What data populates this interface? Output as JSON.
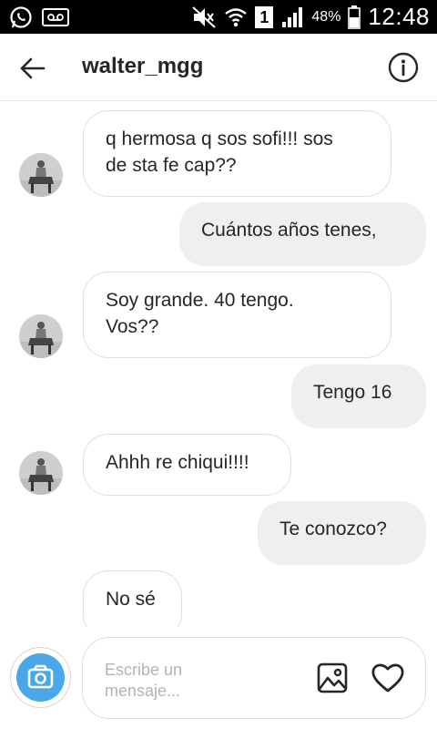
{
  "status_bar": {
    "battery_percent": "48%",
    "time": "12:48",
    "sim_label": "1",
    "icons": [
      "whatsapp-icon",
      "voicemail-icon",
      "mute-icon",
      "wifi-icon",
      "sim-icon",
      "signal-icon",
      "battery-icon"
    ]
  },
  "header": {
    "username": "walter_mgg",
    "back_icon": "arrow-left-icon",
    "info_icon": "info-icon"
  },
  "messages": [
    {
      "from": "other",
      "text_lines": [
        "q hermosa q sos sofi!!! sos",
        "de sta fe cap??"
      ]
    },
    {
      "from": "me",
      "text_lines": [
        "Cuántos años tenes,"
      ]
    },
    {
      "from": "other",
      "text_lines": [
        "Soy grande. 40 tengo.",
        "Vos??"
      ]
    },
    {
      "from": "me",
      "text_lines": [
        "Tengo 16"
      ]
    },
    {
      "from": "other",
      "text_lines": [
        "Ahhh re chiqui!!!!"
      ]
    },
    {
      "from": "me",
      "text_lines": [
        "Te conozco?"
      ]
    },
    {
      "from": "other",
      "text_lines": [
        "No sé"
      ]
    }
  ],
  "composer": {
    "placeholder_line1": "Escribe un",
    "placeholder_line2": "mensaje...",
    "camera_icon": "camera-icon",
    "image_icon": "image-icon",
    "heart_icon": "heart-icon"
  },
  "colors": {
    "camera_blue": "#4aa8ea",
    "outgoing_bubble": "#efefef",
    "bubble_border": "#dedede",
    "text": "#262626"
  }
}
